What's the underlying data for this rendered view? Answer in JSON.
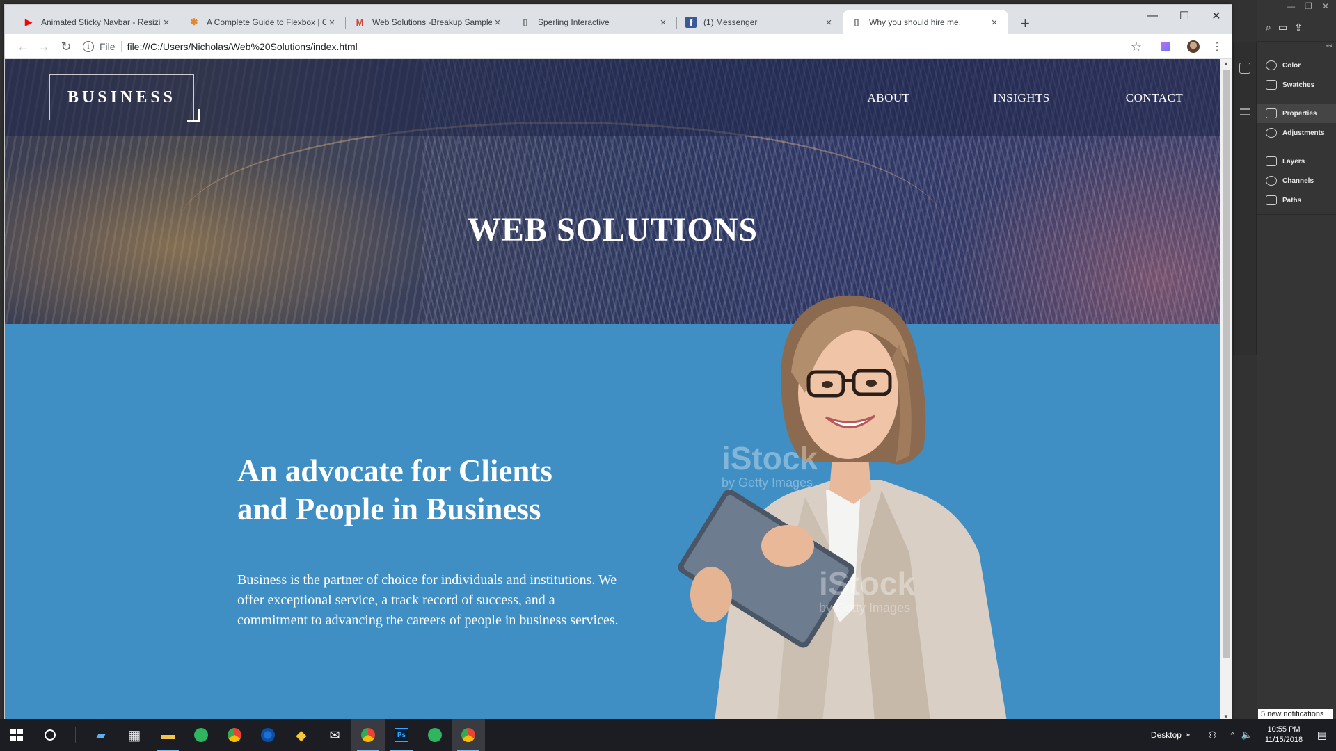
{
  "browser": {
    "tabs": [
      {
        "title": "Animated Sticky Navbar - Resizin",
        "favicon": "youtube-icon"
      },
      {
        "title": "A Complete Guide to Flexbox | C",
        "favicon": "css-tricks-icon"
      },
      {
        "title": "Web Solutions -Breakup Sample",
        "favicon": "gmail-icon"
      },
      {
        "title": "Sperling Interactive",
        "favicon": "page-icon"
      },
      {
        "title": "(1) Messenger",
        "favicon": "facebook-icon"
      },
      {
        "title": "Why you should hire me.",
        "favicon": "page-icon",
        "active": true
      }
    ],
    "address_scheme": "File",
    "address_url": "file:///C:/Users/Nicholas/Web%20Solutions/index.html"
  },
  "site": {
    "logo": "BUSINESS",
    "nav": [
      "ABOUT",
      "INSIGHTS",
      "CONTACT"
    ],
    "hero_title": "WEB SOLUTIONS",
    "headline_line1": "An advocate for Clients",
    "headline_line2": "and People in Business",
    "body": "Business is the partner of choice for individuals and institutions. We offer exceptional service, a track record of success, and a commitment to advancing the careers of people in business services.",
    "watermark": "iStock",
    "watermark_sub": "by Getty Images"
  },
  "photoshop": {
    "panels": [
      {
        "label": "Color",
        "icon": "color-icon"
      },
      {
        "label": "Swatches",
        "icon": "swatches-icon"
      },
      {
        "label": "Properties",
        "icon": "properties-icon",
        "active": true
      },
      {
        "label": "Adjustments",
        "icon": "adjustments-icon"
      },
      {
        "label": "Layers",
        "icon": "layers-icon"
      },
      {
        "label": "Channels",
        "icon": "channels-icon"
      },
      {
        "label": "Paths",
        "icon": "paths-icon"
      }
    ],
    "notification": "5 new notifications"
  },
  "taskbar": {
    "desktop_label": "Desktop",
    "time": "10:55 PM",
    "date": "11/15/2018"
  },
  "colors": {
    "content_bg": "#3f8fc5",
    "nav_overlay": "#1e2448",
    "taskbar": "#1c1d22"
  }
}
